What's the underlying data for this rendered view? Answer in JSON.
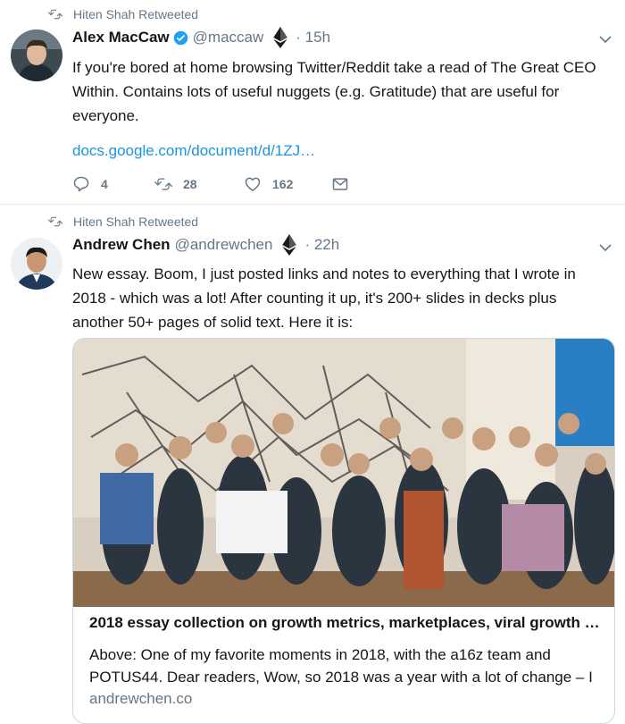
{
  "tweets": [
    {
      "context": "Hiten Shah Retweeted",
      "name": "Alex MacCaw",
      "verified": true,
      "handle": "@maccaw",
      "time": "· 15h",
      "text": "If you're bored at home browsing Twitter/Reddit take a read of The Great CEO Within. Contains lots of useful nuggets (e.g. Gratitude) that are useful for everyone.",
      "link": "docs.google.com/document/d/1ZJ…",
      "replies": "4",
      "retweets": "28",
      "likes": "162"
    },
    {
      "context": "Hiten Shah Retweeted",
      "name": "Andrew Chen",
      "verified": false,
      "handle": "@andrewchen",
      "time": "· 22h",
      "text": "New essay. Boom, I just posted links and notes to everything that I wrote in 2018 - which was a lot! After counting it up, it's 200+ slides in decks plus another 50+ pages of solid text. Here it is:",
      "card": {
        "title": "2018 essay collection on growth metrics, marketplaces, viral growth i…",
        "description": "Above: One of my favorite moments in 2018, with the a16z team and POTUS44.    Dear readers, Wow, so 2018 was a year with a lot of change – I",
        "domain": "andrewchen.co"
      }
    }
  ],
  "colors": {
    "link": "#1b95e0",
    "muted": "#657786",
    "verified": "#1da1f2",
    "text": "#14171a"
  },
  "icons": [
    "retweet-icon",
    "verified-icon",
    "ethereum-icon",
    "chevron-down-icon",
    "reply-icon",
    "heart-icon",
    "dm-icon"
  ]
}
